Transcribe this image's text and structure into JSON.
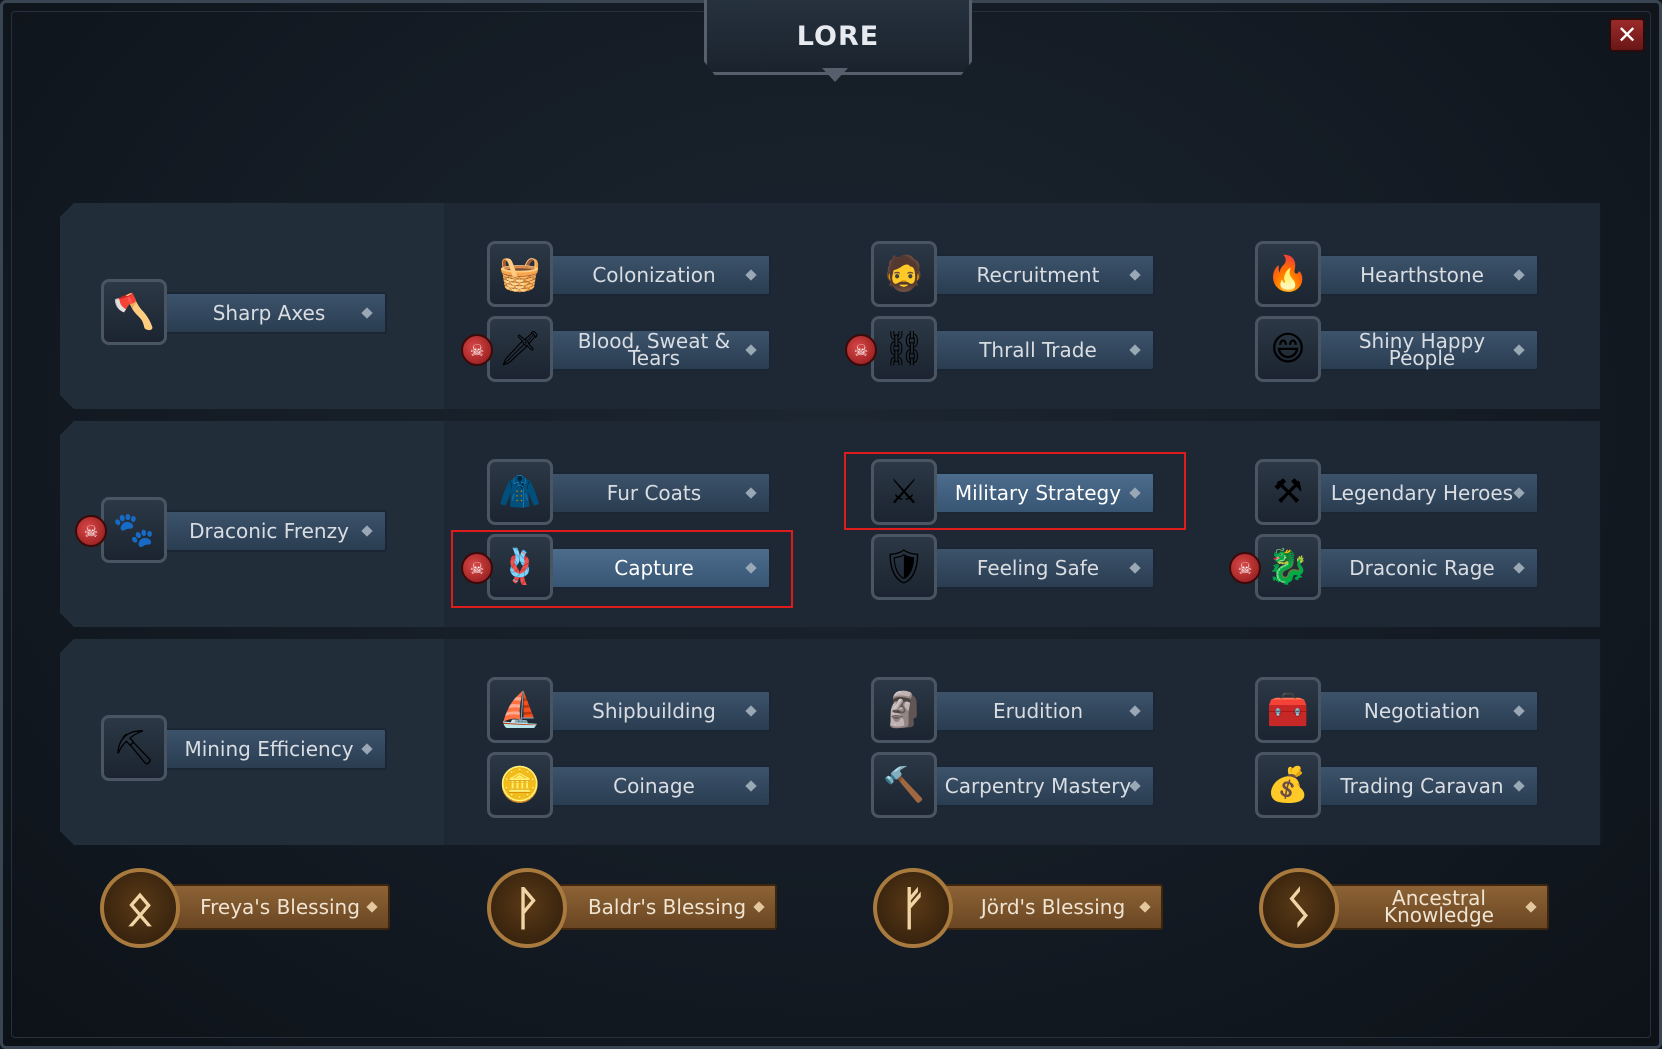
{
  "title": "LORE",
  "close_label": "✕",
  "rows": [
    {
      "first": {
        "label": "Sharp Axes",
        "icon": "axe-icon",
        "glyph": "🪓",
        "badge": false
      },
      "columns": [
        [
          {
            "label": "Colonization",
            "icon": "basket-icon",
            "glyph": "🧺",
            "badge": false
          },
          {
            "label": "Blood, Sweat & Tears",
            "icon": "dagger-icon",
            "glyph": "🗡",
            "badge": true
          }
        ],
        [
          {
            "label": "Recruitment",
            "icon": "viking-face-icon",
            "glyph": "🧔",
            "badge": false
          },
          {
            "label": "Thrall Trade",
            "icon": "shackles-icon",
            "glyph": "⛓",
            "badge": true
          }
        ],
        [
          {
            "label": "Hearthstone",
            "icon": "fire-icon",
            "glyph": "🔥",
            "badge": false
          },
          {
            "label": "Shiny Happy People",
            "icon": "bearded-man-icon",
            "glyph": "😄",
            "badge": false
          }
        ]
      ]
    },
    {
      "first": {
        "label": "Draconic Frenzy",
        "icon": "claw-icon",
        "glyph": "🐾",
        "badge": true
      },
      "columns": [
        [
          {
            "label": "Fur Coats",
            "icon": "fur-icon",
            "glyph": "🧥",
            "badge": false
          },
          {
            "label": "Capture",
            "icon": "capture-icon",
            "glyph": "🪢",
            "badge": true,
            "highlighted": true
          }
        ],
        [
          {
            "label": "Military Strategy",
            "icon": "sword-icon",
            "glyph": "⚔",
            "badge": false,
            "highlighted": true
          },
          {
            "label": "Feeling Safe",
            "icon": "shield-icon",
            "glyph": "🛡",
            "badge": false
          }
        ],
        [
          {
            "label": "Legendary Heroes",
            "icon": "double-axe-icon",
            "glyph": "⚒",
            "badge": false
          },
          {
            "label": "Draconic Rage",
            "icon": "dragon-warrior-icon",
            "glyph": "🐉",
            "badge": true
          }
        ]
      ]
    },
    {
      "first": {
        "label": "Mining Efficiency",
        "icon": "pickaxe-icon",
        "glyph": "⛏",
        "badge": false
      },
      "columns": [
        [
          {
            "label": "Shipbuilding",
            "icon": "longship-icon",
            "glyph": "⛵",
            "badge": false
          },
          {
            "label": "Coinage",
            "icon": "coin-icon",
            "glyph": "🪙",
            "badge": false
          }
        ],
        [
          {
            "label": "Erudition",
            "icon": "runestone-icon",
            "glyph": "🗿",
            "badge": false
          },
          {
            "label": "Carpentry Mastery",
            "icon": "hammer-icon",
            "glyph": "🔨",
            "badge": false
          }
        ],
        [
          {
            "label": "Negotiation",
            "icon": "chest-icon",
            "glyph": "🧰",
            "badge": false
          },
          {
            "label": "Trading Caravan",
            "icon": "trade-coins-icon",
            "glyph": "💰",
            "badge": false
          }
        ]
      ]
    }
  ],
  "blessings": [
    {
      "label": "Freya's Blessing",
      "icon": "othala-rune-icon",
      "glyph": "ᛟ"
    },
    {
      "label": "Baldr's Blessing",
      "icon": "wunjo-rune-icon",
      "glyph": "ᚹ"
    },
    {
      "label": "Jörd's Blessing",
      "icon": "fehu-rune-icon",
      "glyph": "ᚠ"
    },
    {
      "label": "Ancestral Knowledge",
      "icon": "sowilo-rune-icon",
      "glyph": "ᛊ"
    }
  ],
  "badge_icon": "red-dragon-badge-icon",
  "badge_glyph": "☠"
}
